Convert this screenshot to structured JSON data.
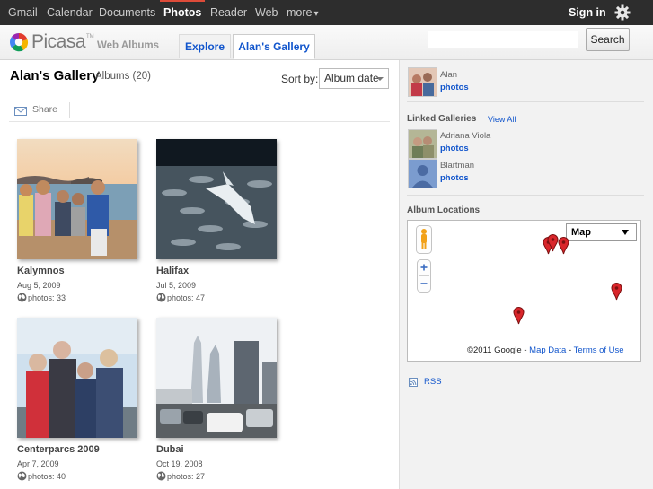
{
  "gbar": {
    "items": [
      "Gmail",
      "Calendar",
      "Documents",
      "Photos",
      "Reader",
      "Web",
      "more"
    ],
    "more_arrow": "▾",
    "active": "Photos",
    "signin": "Sign in",
    "settings_icon": "gear-icon",
    "active_color": "#dd4b39"
  },
  "header": {
    "logo": "Picasa",
    "logo_tm": "TM",
    "subtitle": "Web Albums",
    "tabs": [
      {
        "label": "Explore"
      },
      {
        "label": "Alan's Gallery"
      }
    ],
    "search": {
      "value": "",
      "button": "Search"
    }
  },
  "main": {
    "title": "Alan's Gallery",
    "count": "Albums (20)",
    "sort_label": "Sort by:",
    "sort_value": "Album date",
    "share_label": "Share",
    "albums": [
      {
        "name": "Kalymnos",
        "date": "Aug 5, 2009",
        "photos": "photos: 33"
      },
      {
        "name": "Halifax",
        "date": "Jul 5, 2009",
        "photos": "photos: 47"
      },
      {
        "name": "Centerparcs 2009",
        "date": "Apr 7, 2009",
        "photos": "photos: 40"
      },
      {
        "name": "Dubai",
        "date": "Oct 19, 2008",
        "photos": "photos: 27"
      }
    ]
  },
  "sidebar": {
    "owner": {
      "name": "Alan",
      "link": "photos"
    },
    "linked_title": "Linked Galleries",
    "view_all": "View All",
    "linked": [
      {
        "name": "Adriana Viola",
        "link": "photos"
      },
      {
        "name": "Blartman",
        "link": "photos"
      }
    ],
    "locations_title": "Album Locations",
    "map": {
      "type": "Map",
      "copyright": "©2011 Google - ",
      "map_data": "Map Data",
      "sep": " - ",
      "terms": "Terms of Use",
      "pin_color": "#d9262b"
    },
    "rss": "RSS"
  }
}
